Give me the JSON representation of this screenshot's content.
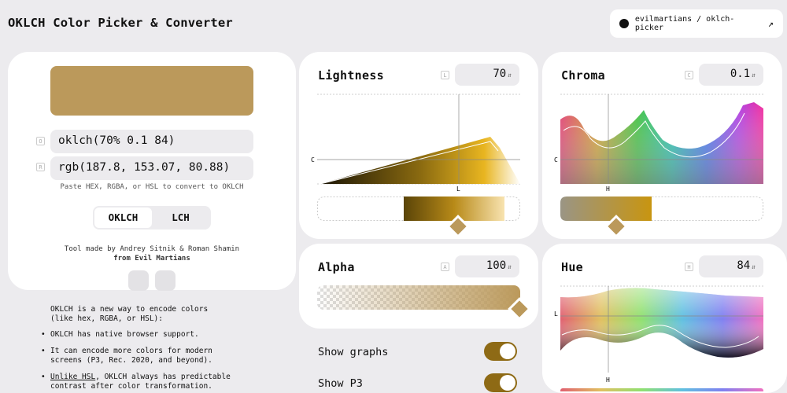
{
  "app_title": "OKLCH Color Picker & Converter",
  "repo_link": {
    "label": "evilmartians / oklch-picker",
    "icon": "github-icon",
    "ext_icon": "external-link-icon"
  },
  "preview": {
    "color": "#bb995b"
  },
  "formats": {
    "oklch_hotkey": "O",
    "oklch_value": "oklch(70% 0.1 84)",
    "rgb_hotkey": "R",
    "rgb_value": "rgb(187.8, 153.07, 80.88)",
    "hint": "Paste HEX, RGBA, or HSL to convert to OKLCH"
  },
  "mode_tabs": [
    {
      "label": "OKLCH",
      "active": true
    },
    {
      "label": "LCH",
      "active": false
    }
  ],
  "credit": {
    "line1": "Tool made by Andrey Sitnik & Roman Shamin",
    "line2": "from Evil Martians"
  },
  "info": {
    "intro": "OKLCH is a new way to encode colors (like hex, RGBA, or HSL):",
    "bullets": [
      "OKLCH has native browser support.",
      "It can encode more colors for modern screens (P3, Rec. 2020, and beyond).",
      "Unlike HSL, OKLCH always has predictable contrast after color transformation."
    ]
  },
  "lightness": {
    "title": "Lightness",
    "hotkey": "L",
    "value": "70",
    "x_axis": "L",
    "y_axis": "C",
    "level": 0.7
  },
  "chroma": {
    "title": "Chroma",
    "hotkey": "C",
    "value": "0.1",
    "x_axis": "H",
    "y_axis": "C",
    "level": 0.25
  },
  "alpha": {
    "title": "Alpha",
    "hotkey": "A",
    "value": "100",
    "level": 1.0
  },
  "hue": {
    "title": "Hue",
    "hotkey": "H",
    "value": "84",
    "x_axis": "H",
    "y_axis": "L",
    "level": 0.233
  },
  "options": [
    {
      "label": "Show graphs",
      "on": true
    },
    {
      "label": "Show P3",
      "on": true
    }
  ],
  "colors": {
    "accent": "#8e6a15",
    "background": "#ecebee",
    "card": "#ffffff",
    "field": "#ecebee"
  }
}
